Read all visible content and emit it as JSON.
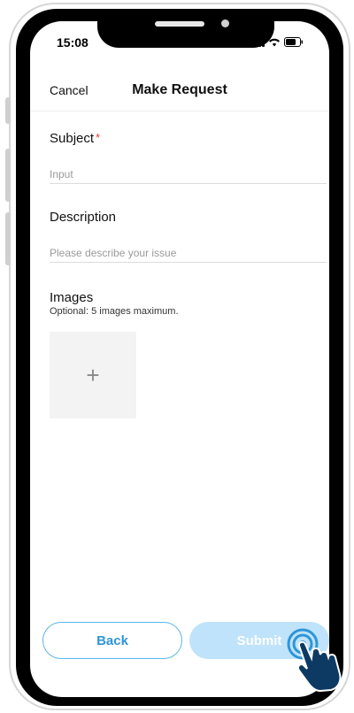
{
  "status_bar": {
    "time": "15:08"
  },
  "nav": {
    "cancel_label": "Cancel",
    "title": "Make Request"
  },
  "form": {
    "subject": {
      "label": "Subject",
      "required_mark": "*",
      "placeholder": "Input"
    },
    "description": {
      "label": "Description",
      "placeholder": "Please describe your issue"
    },
    "images": {
      "label": "Images",
      "hint": "Optional: 5 images maximum.",
      "add_symbol": "+"
    }
  },
  "actions": {
    "back_label": "Back",
    "submit_label": "Submit"
  },
  "colors": {
    "accent": "#2f95d8",
    "submit_disabled": "#bfe3fa",
    "required": "#e53b3b"
  }
}
